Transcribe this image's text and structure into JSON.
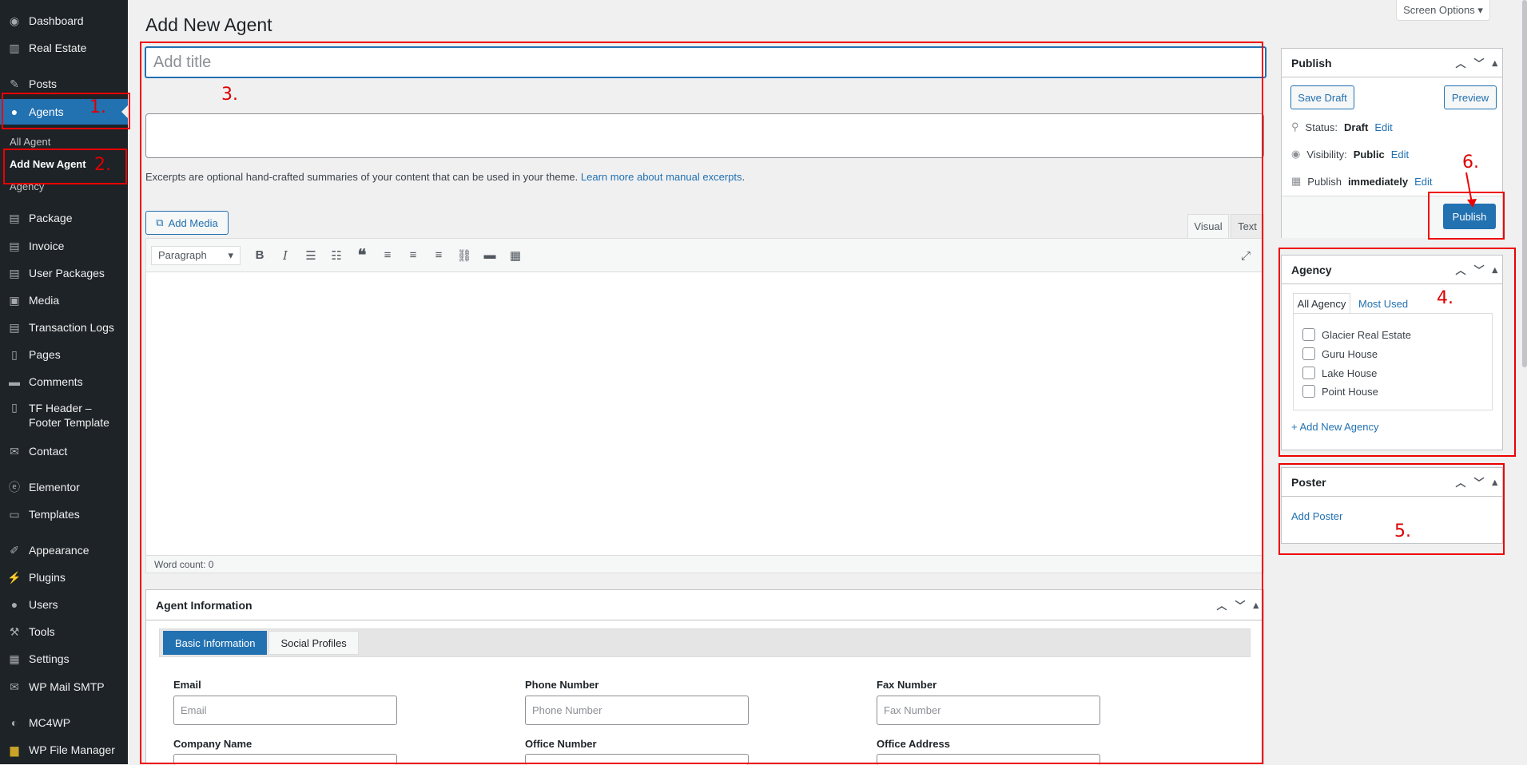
{
  "sidebar": {
    "items": [
      {
        "label": "Dashboard",
        "icon": "dashboard-icon"
      },
      {
        "label": "Real Estate",
        "icon": "building-icon"
      },
      {
        "label": "Posts",
        "icon": "pin-icon"
      },
      {
        "label": "Agents",
        "icon": "user-icon"
      },
      {
        "label": "Package",
        "icon": "package-icon"
      },
      {
        "label": "Invoice",
        "icon": "invoice-icon"
      },
      {
        "label": "User Packages",
        "icon": "list-icon"
      },
      {
        "label": "Media",
        "icon": "media-icon"
      },
      {
        "label": "Transaction Logs",
        "icon": "log-icon"
      },
      {
        "label": "Pages",
        "icon": "page-icon"
      },
      {
        "label": "Comments",
        "icon": "comment-icon"
      },
      {
        "label": "TF Header –",
        "label2": "Footer Template",
        "icon": "template-icon"
      },
      {
        "label": "Contact",
        "icon": "mail-icon"
      },
      {
        "label": "Elementor",
        "icon": "elementor-icon"
      },
      {
        "label": "Templates",
        "icon": "folder-icon"
      },
      {
        "label": "Appearance",
        "icon": "brush-icon"
      },
      {
        "label": "Plugins",
        "icon": "plugin-icon"
      },
      {
        "label": "Users",
        "icon": "users-icon"
      },
      {
        "label": "Tools",
        "icon": "wrench-icon"
      },
      {
        "label": "Settings",
        "icon": "settings-icon"
      },
      {
        "label": "WP Mail SMTP",
        "icon": "smtp-icon"
      },
      {
        "label": "MC4WP",
        "icon": "mc4wp-icon"
      },
      {
        "label": "WP File Manager",
        "icon": "file-manager-icon"
      }
    ],
    "submenu": [
      "All Agent",
      "Add New Agent",
      "Agency"
    ]
  },
  "page": {
    "title": "Add New Agent",
    "screen_options": "Screen Options"
  },
  "title_placeholder": "Add title",
  "excerpt": {
    "note": "Excerpts are optional hand-crafted summaries of your content that can be used in your theme.",
    "link": "Learn more about manual excerpts",
    "end": "."
  },
  "editor": {
    "add_media": "Add Media",
    "tab_visual": "Visual",
    "tab_text": "Text",
    "format": "Paragraph",
    "word_count": "Word count: 0"
  },
  "agent_info": {
    "title": "Agent Information",
    "tabs": [
      "Basic Information",
      "Social Profiles"
    ],
    "fields": [
      {
        "label": "Email",
        "placeholder": "Email"
      },
      {
        "label": "Phone Number",
        "placeholder": "Phone Number"
      },
      {
        "label": "Fax Number",
        "placeholder": "Fax Number"
      }
    ],
    "fields2": [
      "Company Name",
      "Office Number",
      "Office Address"
    ]
  },
  "publish": {
    "title": "Publish",
    "save_draft": "Save Draft",
    "preview": "Preview",
    "status_label": "Status:",
    "status": "Draft",
    "visibility_label": "Visibility:",
    "visibility": "Public",
    "publish_label": "Publish",
    "publish_when": "immediately",
    "edit": "Edit",
    "publish_button": "Publish"
  },
  "agency": {
    "title": "Agency",
    "tab_all": "All Agency",
    "tab_most": "Most Used",
    "options": [
      "Glacier Real Estate",
      "Guru House",
      "Lake House",
      "Point House"
    ],
    "add_new": "+ Add New Agency"
  },
  "poster": {
    "title": "Poster",
    "add": "Add Poster"
  },
  "annotations": [
    "1.",
    "2.",
    "3.",
    "4.",
    "5.",
    "6."
  ],
  "colors": {
    "annotation": "#ee0000",
    "accent": "#2271b1",
    "sidebar": "#1d2327"
  }
}
